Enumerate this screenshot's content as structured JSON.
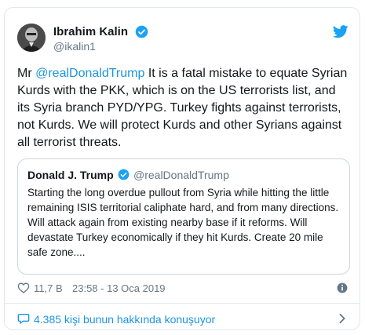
{
  "author": {
    "name": "Ibrahim Kalin",
    "handle": "@ikalin1",
    "verified": true
  },
  "tweet": {
    "prefix": "Mr ",
    "mention": "@realDonaldTrump",
    "body": " It is a fatal mistake to equate Syrian Kurds with the PKK, which is on the US terrorists list, and its Syria branch PYD/YPG. Turkey fights against terrorists, not Kurds. We will protect Kurds and other Syrians against all terrorist threats."
  },
  "quoted": {
    "name": "Donald J. Trump",
    "handle": "@realDonaldTrump",
    "verified": true,
    "text": "Starting the long overdue pullout from Syria while hitting the little remaining ISIS territorial caliphate hard, and from many directions. Will attack again from existing nearby base if it reforms. Will devastate Turkey economically if they hit Kurds. Create 20 mile safe zone...."
  },
  "footer": {
    "likes": "11,7 B",
    "timestamp": "23:58 - 13 Oca 2019",
    "conversation": "4.385 kişi bunun hakkında konuşuyor"
  },
  "colors": {
    "accent": "#1da1f2",
    "link": "#1b95e0",
    "muted": "#657786",
    "border": "#e1e8ed"
  }
}
